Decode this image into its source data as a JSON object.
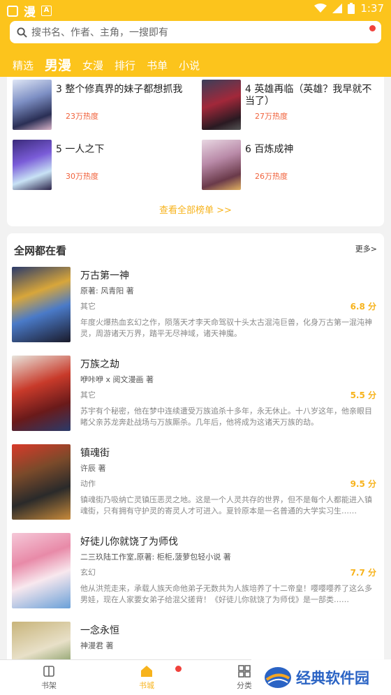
{
  "status_bar": {
    "time": "1:37",
    "logo_text": "漫"
  },
  "search": {
    "placeholder": "搜书名、作者、主角，一搜即有"
  },
  "tabs": [
    {
      "label": "精选"
    },
    {
      "label": "男漫"
    },
    {
      "label": "女漫"
    },
    {
      "label": "排行"
    },
    {
      "label": "书单"
    },
    {
      "label": "小说"
    }
  ],
  "ranking": {
    "items": [
      {
        "title": "3 整个修真界的妹子都想抓我",
        "heat": "23万热度"
      },
      {
        "title": "4 英雄再临（英雄？我早就不当了）",
        "heat": "27万热度"
      },
      {
        "title": "5 一人之下",
        "heat": "30万热度"
      },
      {
        "title": "6 百炼成神",
        "heat": "26万热度"
      }
    ],
    "view_all": "查看全部榜单 >>"
  },
  "watching": {
    "title": "全网都在看",
    "more": "更多>",
    "books": [
      {
        "title": "万古第一神",
        "author": "原著: 风青阳 著",
        "genre": "其它",
        "score": "6.8 分",
        "desc": "年度火爆热血玄幻之作，陨落天才李天命驾驭十头太古混沌巨兽，化身万古第一混沌神灵，周游诸天万界，踏平无尽神域，诸天神魔。"
      },
      {
        "title": "万族之劫",
        "author": "咿咔咿 x 阅文漫画 著",
        "genre": "其它",
        "score": "5.5 分",
        "desc": "苏宇有个秘密，他在梦中连续遭受万族追杀十多年，永无休止。十八岁这年，他亲眼目睹父亲苏龙奔赴战场与万族厮杀。几年后，他将成为这诸天万族的劫。"
      },
      {
        "title": "镇魂街",
        "author": "许辰 著",
        "genre": "动作",
        "score": "9.5 分",
        "desc": "镇魂街乃吸纳亡灵镇压恶灵之地。这是一个人灵共存的世界，但不是每个人都能进入镇魂街，只有拥有守护灵的寄灵人才可进入。夏铃原本是一名普通的大学实习生……"
      },
      {
        "title": "好徒儿你就饶了为师伐",
        "author": "二三玖陆工作室,原著: 柜柜,菠萝包轻小说 著",
        "genre": "玄幻",
        "score": "7.7 分",
        "desc": "他从洪荒走来，承载人族天命他弟子无数共为人族培养了十二帝皇！嘤嘤嘤养了这么多男娃，现在人家要女弟子给混父搓背！《好徒儿你就饶了为师伐》是一部类……"
      },
      {
        "title": "一念永恒",
        "author": "神漫君 著",
        "genre": "",
        "score": "",
        "desc": ""
      }
    ]
  },
  "bottom_nav": [
    {
      "label": "书架"
    },
    {
      "label": "书城"
    },
    {
      "label": "分类"
    }
  ],
  "watermark": {
    "text": "经典软件园"
  }
}
